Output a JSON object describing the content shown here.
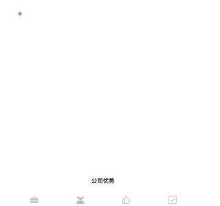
{
  "section": {
    "title": "公司优势"
  },
  "icons": [
    "briefcase-icon",
    "team-icon",
    "thumbs-up-icon",
    "checkbox-icon"
  ],
  "colors": {
    "logo_green": "#3bb34a",
    "icon_gray": "#c8c8c8",
    "title_text": "#222222"
  }
}
